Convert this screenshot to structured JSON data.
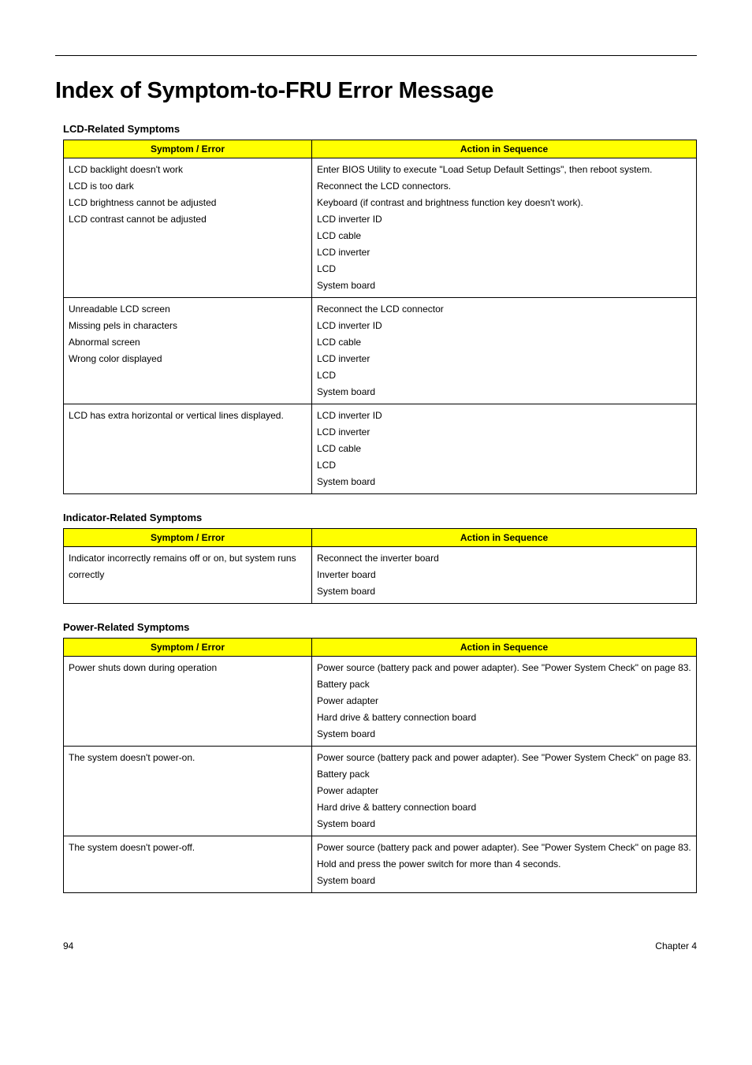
{
  "page_title": "Index of Symptom-to-FRU Error Message",
  "tables": [
    {
      "caption": "LCD-Related Symptoms",
      "col1": "Symptom / Error",
      "col2": "Action in Sequence",
      "rows": [
        {
          "s": "LCD backlight doesn't work\nLCD is too dark\nLCD brightness cannot be adjusted\nLCD contrast cannot be adjusted",
          "a": "Enter BIOS Utility to execute \"Load Setup Default Settings\", then reboot system.\nReconnect the LCD connectors.\nKeyboard (if contrast and brightness function key doesn't work).\nLCD inverter ID\nLCD cable\nLCD inverter\nLCD\nSystem board"
        },
        {
          "s": "Unreadable LCD screen\nMissing pels in characters\nAbnormal screen\nWrong color displayed",
          "a": "Reconnect the LCD connector\nLCD inverter ID\nLCD cable\nLCD inverter\nLCD\nSystem board"
        },
        {
          "s": "LCD has extra horizontal or vertical lines displayed.",
          "a": "LCD inverter ID\nLCD inverter\nLCD cable\nLCD\nSystem board"
        }
      ]
    },
    {
      "caption": "Indicator-Related Symptoms",
      "col1": "Symptom / Error",
      "col2": "Action in Sequence",
      "rows": [
        {
          "s": "Indicator incorrectly remains off or on, but system runs correctly",
          "a": "Reconnect the inverter board\nInverter board\nSystem board"
        }
      ]
    },
    {
      "caption": "Power-Related Symptoms",
      "col1": "Symptom / Error",
      "col2": "Action in Sequence",
      "rows": [
        {
          "s": "Power shuts down during operation",
          "a": "Power source (battery pack and power adapter). See \"Power System Check\" on page 83.\nBattery pack\nPower adapter\nHard drive & battery connection board\nSystem board"
        },
        {
          "s": "The system doesn't power-on.",
          "a": "Power source (battery pack and power adapter). See \"Power System Check\" on page 83.\nBattery pack\nPower adapter\nHard drive & battery connection board\nSystem board"
        },
        {
          "s": "The system doesn't power-off.",
          "a": "Power source (battery pack and power adapter). See \"Power System Check\" on page 83.\nHold and press the power switch for more than 4 seconds.\nSystem board"
        }
      ]
    }
  ],
  "footer_left": "94",
  "footer_right": "Chapter 4"
}
